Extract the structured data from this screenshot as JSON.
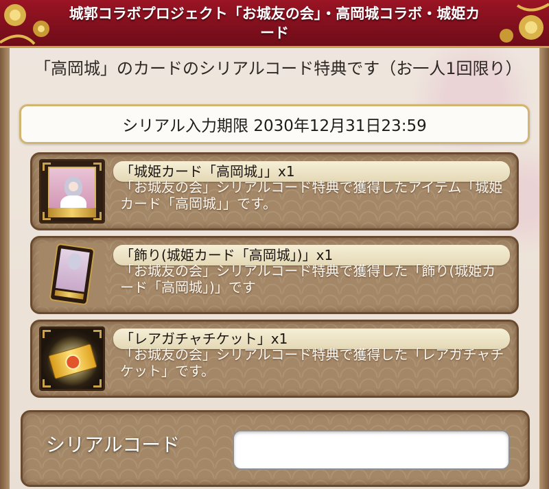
{
  "header": {
    "title": "城郭コラボプロジェクト「お城友の会」・高岡城コラボ・城姫カード"
  },
  "intro_text": "「高岡城」のカードのシリアルコード特典です（お一人1回限り）",
  "deadline": {
    "text": "シリアル入力期限 2030年12月31日23:59"
  },
  "items": [
    {
      "title": "「城姫カード「高岡城」」x1",
      "description": "「お城友の会」シリアルコード特典で獲得したアイテム「城姫カード「高岡城」」です。",
      "icon": "castle-princess-card-icon"
    },
    {
      "title": "「飾り(城姫カード「高岡城」)」x1",
      "description": "「お城友の会」シリアルコード特典で獲得した「飾り(城姫カード「高岡城」)」です",
      "icon": "decoration-card-icon"
    },
    {
      "title": "「レアガチャチケット」x1",
      "description": "「お城友の会」シリアルコード特典で獲得した「レアガチャチケット」です。",
      "icon": "rare-gacha-ticket-icon"
    }
  ],
  "serial": {
    "label": "シリアルコード",
    "value": "",
    "placeholder": ""
  },
  "colors": {
    "header_red": "#8a1020",
    "gold_border": "#d2b570",
    "card_brown": "#a48766"
  }
}
